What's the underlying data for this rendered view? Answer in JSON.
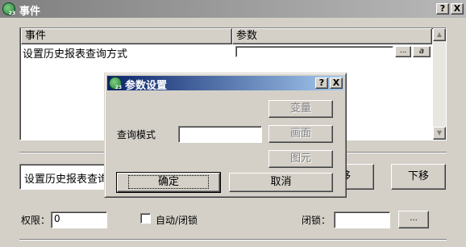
{
  "window": {
    "title": "事件",
    "help_label": "?",
    "close_label": "X"
  },
  "event_table": {
    "columns": [
      "事件",
      "参数"
    ],
    "rows": [
      {
        "event": "设置历史报表查询方式",
        "param": ""
      }
    ],
    "ellipsis_label": "...",
    "param_icon": "a",
    "scroll_up": "▲",
    "scroll_down": "▼"
  },
  "event_detail": {
    "value": "设置历史报表查询方式"
  },
  "move_buttons": {
    "up_partial": "移",
    "down": "下移"
  },
  "bottom": {
    "permission_label": "权限：",
    "permission_value": "0",
    "auto_lock_label": "自动/闭锁",
    "lock_label": "闭锁：",
    "lock_value": "",
    "ellipsis_label": "..."
  },
  "dialog": {
    "title": "参数设置",
    "help_label": "?",
    "close_label": "X",
    "query_mode_label": "查询模式",
    "query_mode_value": "",
    "side_buttons": [
      "变量",
      "画面",
      "图元"
    ],
    "ok_label": "确定",
    "cancel_label": "取消"
  }
}
